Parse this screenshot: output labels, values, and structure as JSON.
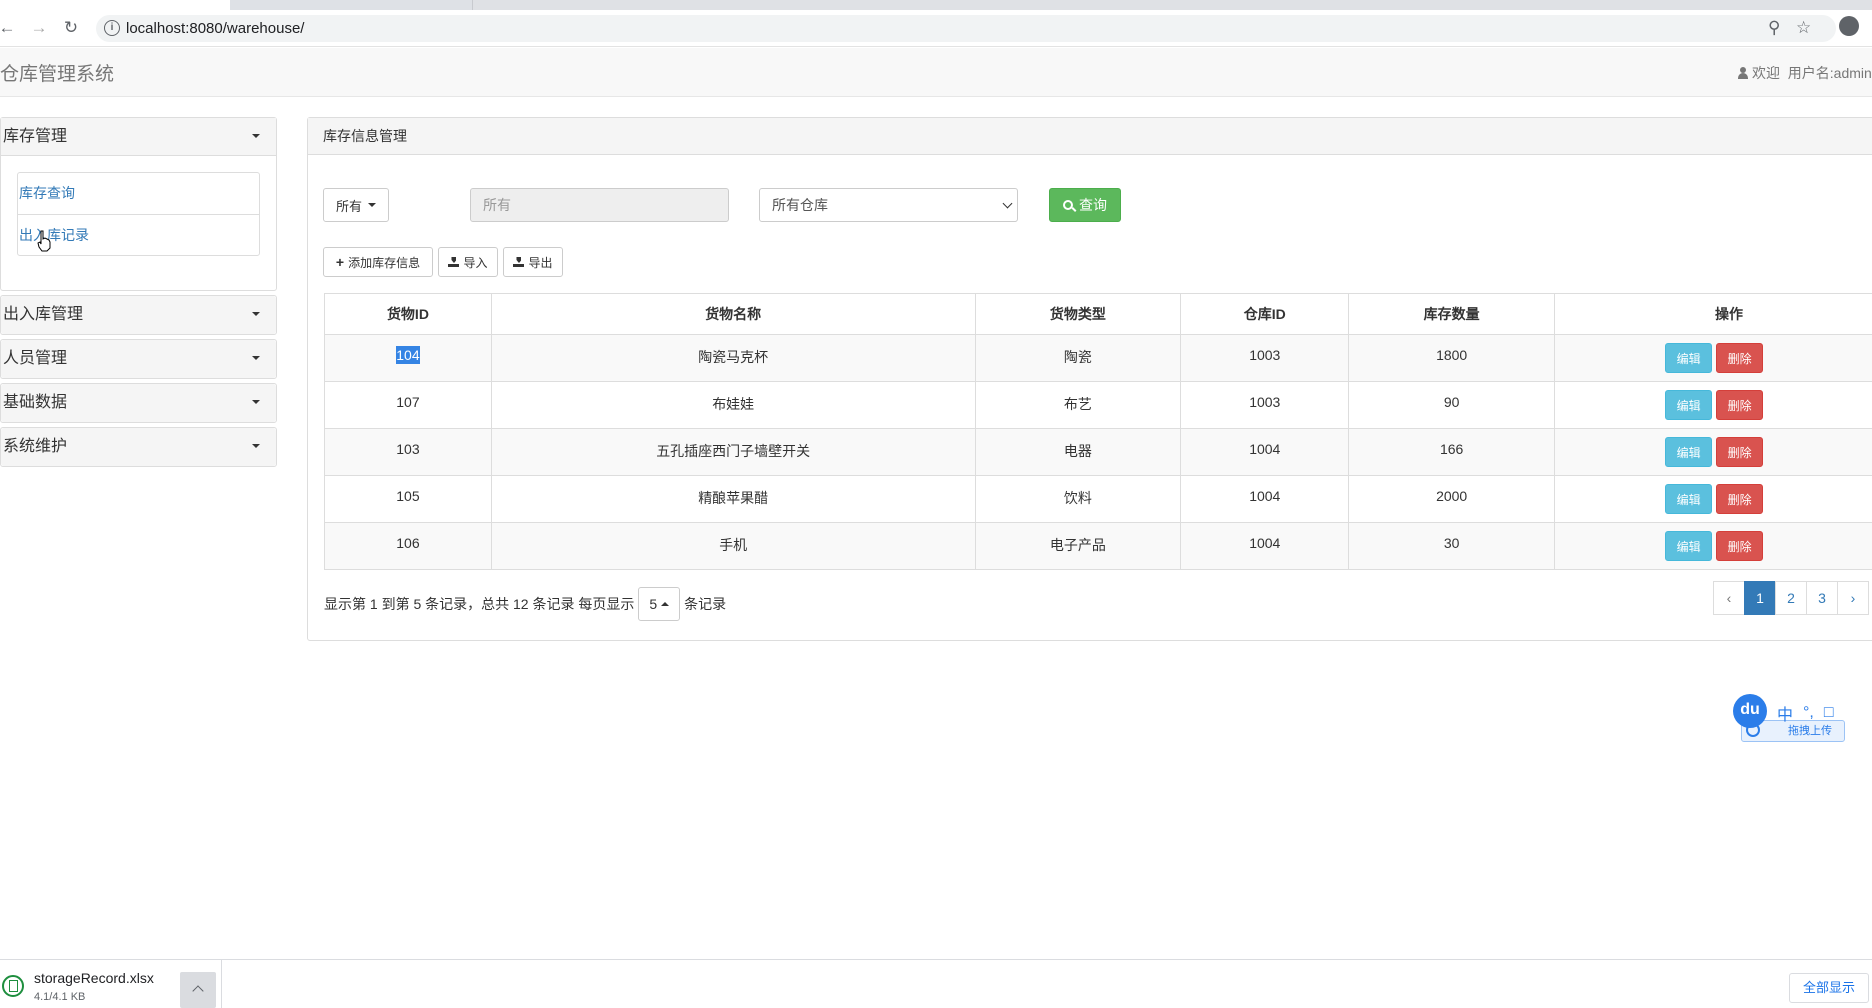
{
  "browser": {
    "url": "localhost:8080/warehouse/",
    "icons": {
      "back": "back-arrow-icon",
      "forward": "forward-arrow-icon",
      "reload": "reload-icon",
      "info": "info-icon",
      "key": "key-icon",
      "star": "star-icon",
      "profile": "profile-icon"
    }
  },
  "header": {
    "brand": "仓库管理系统",
    "welcome": "欢迎",
    "username": "用户名:admin"
  },
  "sidebar": {
    "sections": [
      {
        "label": "库存管理",
        "expanded": true,
        "items": [
          "库存查询",
          "出入库记录"
        ]
      },
      {
        "label": "出入库管理",
        "expanded": false
      },
      {
        "label": "人员管理",
        "expanded": false
      },
      {
        "label": "基础数据",
        "expanded": false
      },
      {
        "label": "系统维护",
        "expanded": false
      }
    ]
  },
  "main": {
    "panel_title": "库存信息管理",
    "filter": {
      "type_dropdown": "所有",
      "keyword_placeholder": "所有",
      "warehouse_select": "所有仓库",
      "query_button": "查询"
    },
    "actions": {
      "add": "添加库存信息",
      "import": "导入",
      "export": "导出"
    },
    "table": {
      "columns": [
        "货物ID",
        "货物名称",
        "货物类型",
        "仓库ID",
        "库存数量",
        "操作"
      ],
      "rows": [
        {
          "id": "104",
          "name": "陶瓷马克杯",
          "type": "陶瓷",
          "warehouse": "1003",
          "qty": "1800"
        },
        {
          "id": "107",
          "name": "布娃娃",
          "type": "布艺",
          "warehouse": "1003",
          "qty": "90"
        },
        {
          "id": "103",
          "name": "五孔插座西门子墙壁开关",
          "type": "电器",
          "warehouse": "1004",
          "qty": "166"
        },
        {
          "id": "105",
          "name": "精酿苹果醋",
          "type": "饮料",
          "warehouse": "1004",
          "qty": "2000"
        },
        {
          "id": "106",
          "name": "手机",
          "type": "电子产品",
          "warehouse": "1004",
          "qty": "30"
        }
      ],
      "edit_label": "编辑",
      "delete_label": "删除"
    },
    "pager": {
      "summary": "显示第 1 到第 5 条记录，总共 12 条记录 每页显示",
      "page_size": "5",
      "suffix": "条记录",
      "prev": "‹",
      "pages": [
        "1",
        "2",
        "3"
      ],
      "next": "›",
      "current": "1"
    }
  },
  "ime": {
    "logo": "du",
    "mode": "中",
    "punct": "°,",
    "upload": "拖拽上传"
  },
  "downloads": {
    "file_name": "storageRecord.xlsx",
    "file_size": "4.1/4.1 KB",
    "show_all": "全部显示"
  },
  "colors": {
    "primary": "#337ab7",
    "success": "#5cb85c",
    "info": "#5bc0de",
    "danger": "#d9534f",
    "selection": "#3584e4"
  }
}
